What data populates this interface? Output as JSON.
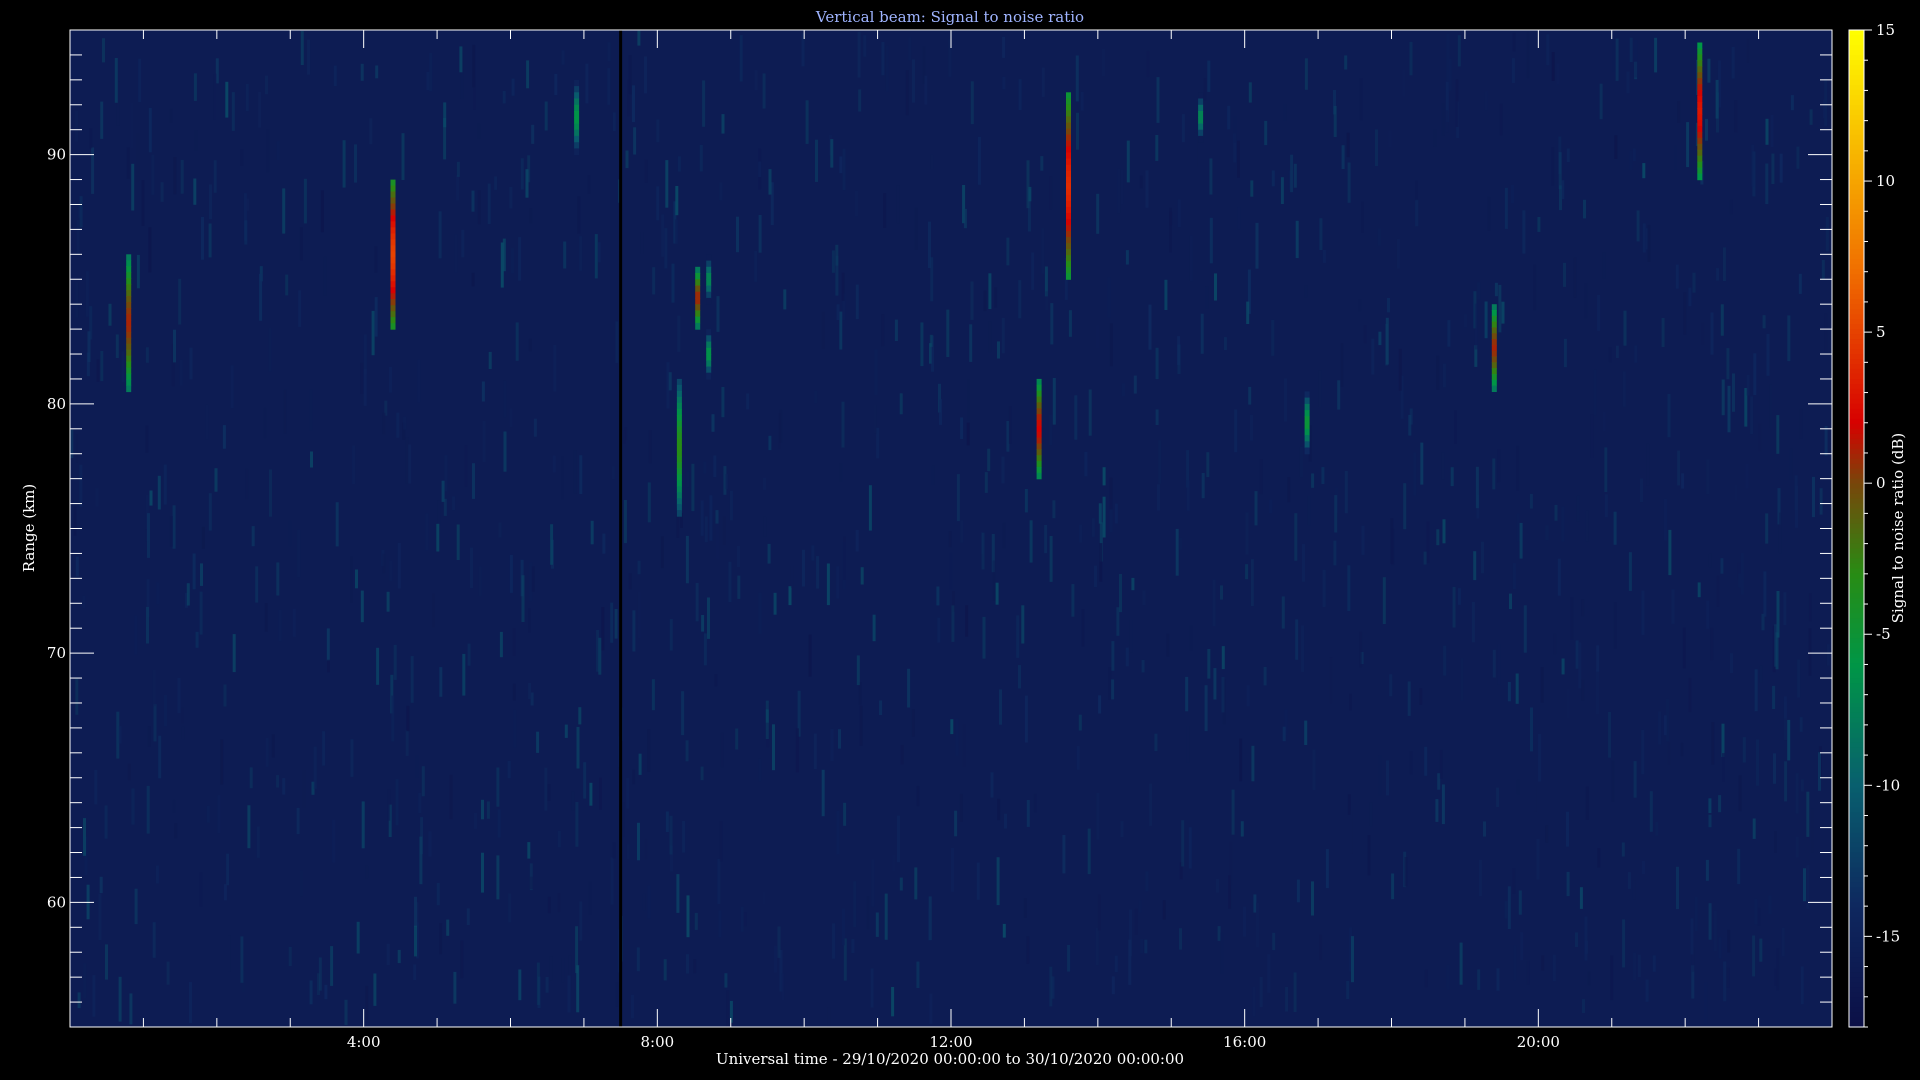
{
  "chart_data": {
    "type": "heatmap",
    "title": "Vertical beam: Signal to noise ratio",
    "xlabel": "Universal time - 29/10/2020 00:00:00 to 30/10/2020 00:00:00",
    "ylabel": "Range (km)",
    "colorbar_label": "Signal to noise ratio (dB)",
    "x_unit": "hours UT",
    "xlim": [
      0,
      24
    ],
    "ylim": [
      55,
      95
    ],
    "zlim": [
      -18,
      15
    ],
    "x_ticks": [
      {
        "value": 4,
        "label": "4:00"
      },
      {
        "value": 8,
        "label": "8:00"
      },
      {
        "value": 12,
        "label": "12:00"
      },
      {
        "value": 16,
        "label": "16:00"
      },
      {
        "value": 20,
        "label": "20:00"
      }
    ],
    "y_ticks": [
      {
        "value": 60,
        "label": "60"
      },
      {
        "value": 70,
        "label": "70"
      },
      {
        "value": 80,
        "label": "80"
      },
      {
        "value": 90,
        "label": "90"
      }
    ],
    "colorbar_ticks": [
      {
        "value": 15,
        "label": "15"
      },
      {
        "value": 10,
        "label": "10"
      },
      {
        "value": 5,
        "label": "5"
      },
      {
        "value": 0,
        "label": "0"
      },
      {
        "value": -5,
        "label": "-5"
      },
      {
        "value": -10,
        "label": "-10"
      },
      {
        "value": -15,
        "label": "-15"
      }
    ],
    "data_gap": {
      "time_h": 7.5
    },
    "background_snr_db": -16,
    "echoes": [
      {
        "time_h": 0.8,
        "range_km": [
          80.5,
          86
        ],
        "peak_snr_db": 1
      },
      {
        "time_h": 4.4,
        "range_km": [
          83,
          89
        ],
        "peak_snr_db": 5
      },
      {
        "time_h": 6.9,
        "range_km": [
          90,
          93
        ],
        "peak_snr_db": -6
      },
      {
        "time_h": 8.3,
        "range_km": [
          75.5,
          81
        ],
        "peak_snr_db": -3
      },
      {
        "time_h": 8.55,
        "range_km": [
          83,
          85.5
        ],
        "peak_snr_db": 1
      },
      {
        "time_h": 8.7,
        "range_km": [
          81,
          83
        ],
        "peak_snr_db": -6
      },
      {
        "time_h": 8.7,
        "range_km": [
          84,
          86
        ],
        "peak_snr_db": -7
      },
      {
        "time_h": 13.2,
        "range_km": [
          77,
          81
        ],
        "peak_snr_db": 2
      },
      {
        "time_h": 13.6,
        "range_km": [
          85,
          92.5
        ],
        "peak_snr_db": 4
      },
      {
        "time_h": 15.4,
        "range_km": [
          90.5,
          92.5
        ],
        "peak_snr_db": -7
      },
      {
        "time_h": 16.85,
        "range_km": [
          78,
          80.5
        ],
        "peak_snr_db": -5
      },
      {
        "time_h": 19.4,
        "range_km": [
          80.5,
          84
        ],
        "peak_snr_db": 1
      },
      {
        "time_h": 22.2,
        "range_km": [
          89,
          94.5
        ],
        "peak_snr_db": 3
      }
    ]
  }
}
